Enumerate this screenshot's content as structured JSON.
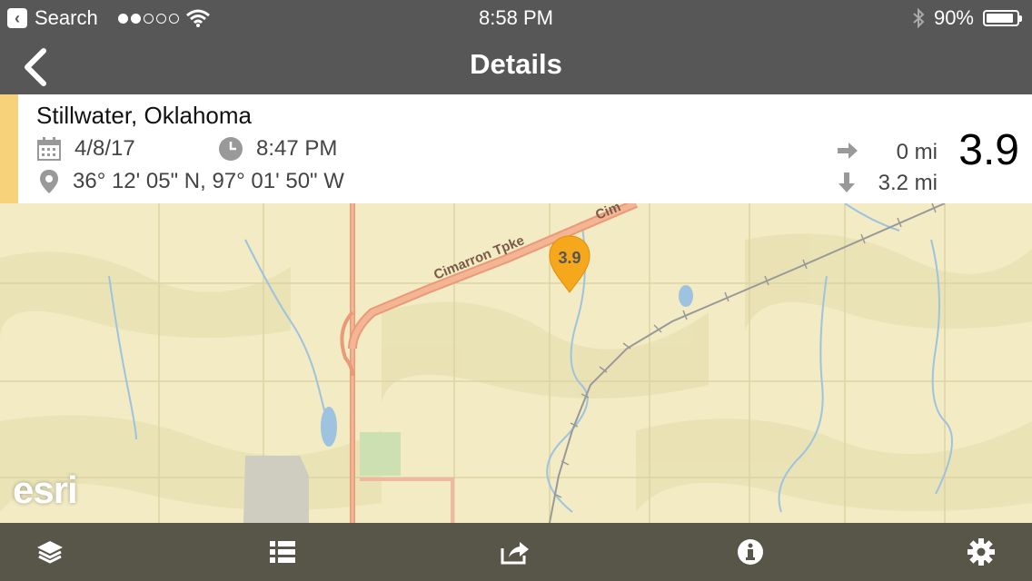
{
  "status_bar": {
    "back_app": "Search",
    "time": "8:58 PM",
    "battery": "90%",
    "battery_level": 0.9
  },
  "nav": {
    "title": "Details"
  },
  "detail": {
    "location": "Stillwater, Oklahoma",
    "date": "4/8/17",
    "time": "8:47 PM",
    "coordinates": "36° 12' 05\" N, 97° 01' 50\" W",
    "distance_horizontal": "0 mi",
    "distance_depth": "3.2 mi",
    "magnitude": "3.9",
    "accent_color": "#f8d27a"
  },
  "map": {
    "road_label": "Cimarron Tpke",
    "road_label_partial": "Cim",
    "marker_label": "3.9",
    "attribution": "esri"
  },
  "tab_bar": {
    "items": [
      "layers-icon",
      "list-icon",
      "share-icon",
      "info-icon",
      "gear-icon"
    ]
  }
}
